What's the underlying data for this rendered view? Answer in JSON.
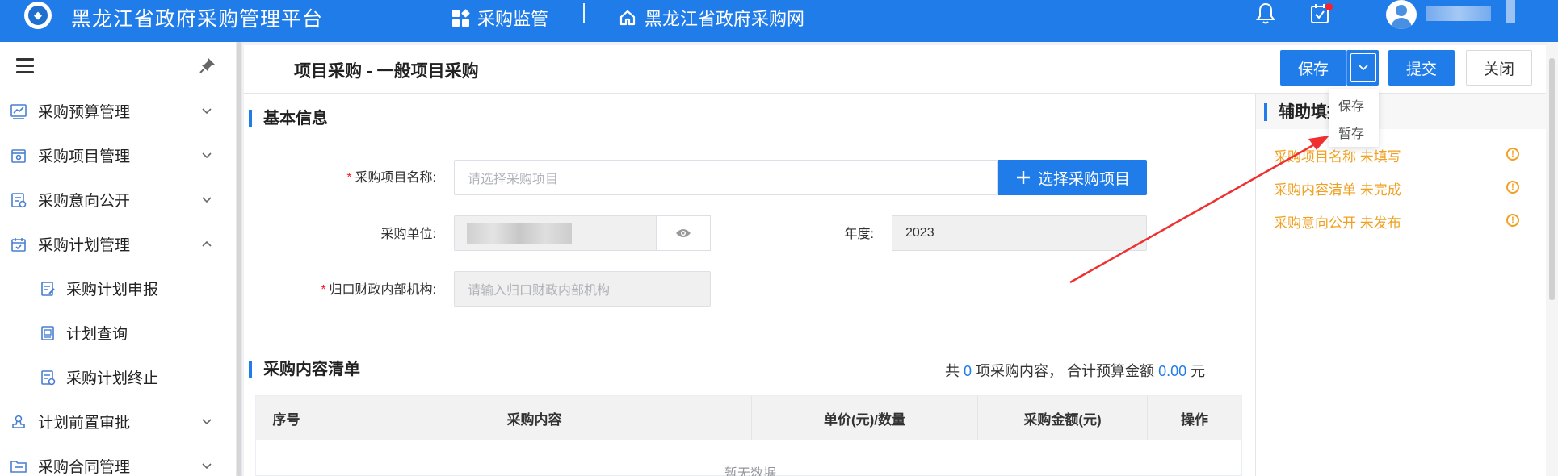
{
  "header": {
    "app_title": "黑龙江省政府采购管理平台",
    "nav": [
      {
        "label": "采购监管",
        "icon": "grid-icon"
      },
      {
        "label": "黑龙江省政府采购网",
        "icon": "home-icon"
      }
    ],
    "accent_color": "#1f7ce8"
  },
  "sidebar": {
    "items": [
      {
        "label": "采购预算管理",
        "icon": "chart-icon",
        "expanded": false
      },
      {
        "label": "采购项目管理",
        "icon": "project-icon",
        "expanded": false
      },
      {
        "label": "采购意向公开",
        "icon": "notice-icon",
        "expanded": false
      },
      {
        "label": "采购计划管理",
        "icon": "calendar-icon",
        "expanded": true
      },
      {
        "label": "采购计划申报",
        "icon": "edit-doc-icon",
        "sub": true
      },
      {
        "label": "计划查询",
        "icon": "doc-icon",
        "sub": true
      },
      {
        "label": "采购计划终止",
        "icon": "stop-doc-icon",
        "sub": true
      },
      {
        "label": "计划前置审批",
        "icon": "stamp-icon",
        "expanded": false
      },
      {
        "label": "采购合同管理",
        "icon": "folder-icon",
        "expanded": false
      }
    ]
  },
  "page": {
    "title": "项目采购 - 一般项目采购",
    "buttons": {
      "save": "保存",
      "submit": "提交",
      "close": "关闭"
    },
    "save_menu": [
      "保存",
      "暂存"
    ]
  },
  "basic_info": {
    "title": "基本信息",
    "project_name": {
      "label": "采购项目名称:",
      "required": "*",
      "placeholder": "请选择采购项目",
      "button": "选择采购项目"
    },
    "unit": {
      "label": "采购单位:"
    },
    "year": {
      "label": "年度:",
      "value": "2023"
    },
    "finance_dept": {
      "label": "归口财政内部机构:",
      "required": "*",
      "placeholder": "请输入归口财政内部机构"
    }
  },
  "content_list": {
    "title": "采购内容清单",
    "summary_prefix": "共",
    "count": "0",
    "summary_mid": "项采购内容， 合计预算金额",
    "amount": "0.00",
    "summary_suffix": "元",
    "columns": [
      "序号",
      "采购内容",
      "单价(元)/数量",
      "采购金额(元)",
      "操作"
    ],
    "empty_text": "暂无数据"
  },
  "assist": {
    "title": "辅助填报",
    "items": [
      "采购项目名称 未填写",
      "采购内容清单 未完成",
      "采购意向公开 未发布"
    ],
    "warn_color": "#f0a020"
  }
}
